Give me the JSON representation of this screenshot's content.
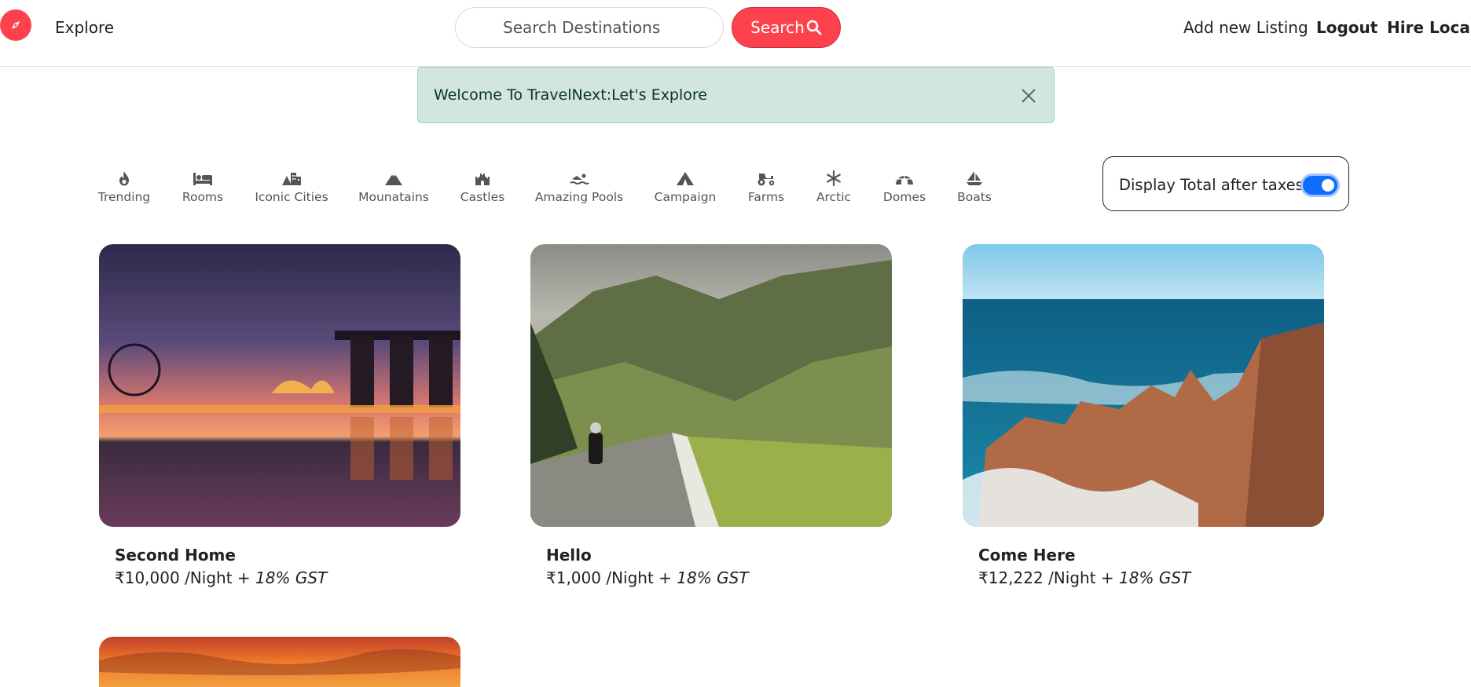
{
  "nav": {
    "brand_icon": "compass-icon",
    "explore": "Explore",
    "search_placeholder": "Search Destinations",
    "search_button": "Search",
    "add_listing": "Add new Listing",
    "logout": "Logout",
    "hire_local": "Hire Local",
    "accent_color": "#fe424d"
  },
  "flash": {
    "message": "Welcome To TravelNext:Let's Explore",
    "background": "#d1e7dd"
  },
  "filters": [
    {
      "label": "Trending",
      "icon": "fire-icon"
    },
    {
      "label": "Rooms",
      "icon": "bed-icon"
    },
    {
      "label": "Iconic Cities",
      "icon": "city-icon"
    },
    {
      "label": "Mounatains",
      "icon": "mountain-icon"
    },
    {
      "label": "Castles",
      "icon": "castle-icon"
    },
    {
      "label": "Amazing Pools",
      "icon": "swimmer-icon"
    },
    {
      "label": "Campaign",
      "icon": "tent-icon"
    },
    {
      "label": "Farms",
      "icon": "tractor-icon"
    },
    {
      "label": "Arctic",
      "icon": "snowflake-icon"
    },
    {
      "label": "Domes",
      "icon": "igloo-icon"
    },
    {
      "label": "Boats",
      "icon": "sailboat-icon"
    }
  ],
  "tax_toggle": {
    "label": "Display Total after taxes",
    "enabled": true
  },
  "listings": [
    {
      "title": "Second Home",
      "price": "₹10,000 /Night + ",
      "tax": "18% GST",
      "image": "city skyline at dusk"
    },
    {
      "title": "Hello",
      "price": "₹1,000 /Night + ",
      "tax": "18% GST",
      "image": "motorcyclist on mountain road"
    },
    {
      "title": "Come Here",
      "price": "₹12,222 /Night + ",
      "tax": "18% GST",
      "image": "coastal rock formations"
    }
  ]
}
